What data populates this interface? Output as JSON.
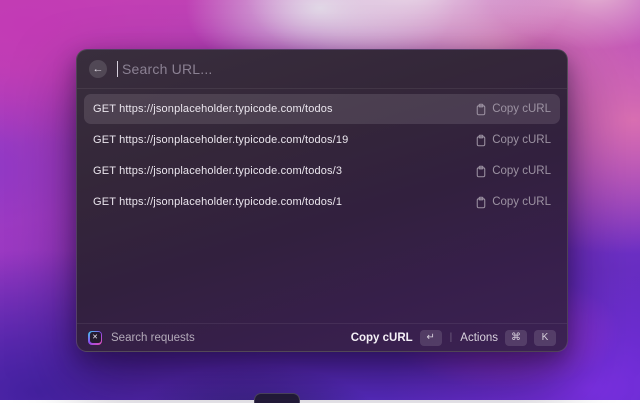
{
  "search": {
    "placeholder": "Search URL...",
    "back_icon": "←"
  },
  "rows": [
    {
      "label": "GET https://jsonplaceholder.typicode.com/todos",
      "action": "Copy cURL",
      "selected": true
    },
    {
      "label": "GET https://jsonplaceholder.typicode.com/todos/19",
      "action": "Copy cURL",
      "selected": false
    },
    {
      "label": "GET https://jsonplaceholder.typicode.com/todos/3",
      "action": "Copy cURL",
      "selected": false
    },
    {
      "label": "GET https://jsonplaceholder.typicode.com/todos/1",
      "action": "Copy cURL",
      "selected": false
    }
  ],
  "footer": {
    "left_label": "Search requests",
    "extension_glyph": "✕",
    "primary_action": "Copy cURL",
    "primary_key": "↵",
    "separator": "|",
    "actions_label": "Actions",
    "actions_keys": [
      "⌘",
      "K"
    ]
  },
  "colors": {
    "wallpaper_magenta": "#c23ab5",
    "wallpaper_pink": "#d671ae",
    "wallpaper_indigo": "#44219f",
    "wallpaper_violet": "#7b30e2",
    "panel_top": "#392e3d",
    "panel_bottom": "#3c2254",
    "selected_row_bg": "rgba(244,236,246,0.12)",
    "text_primary": "#eae5ed",
    "text_muted": "#9c92a2"
  }
}
